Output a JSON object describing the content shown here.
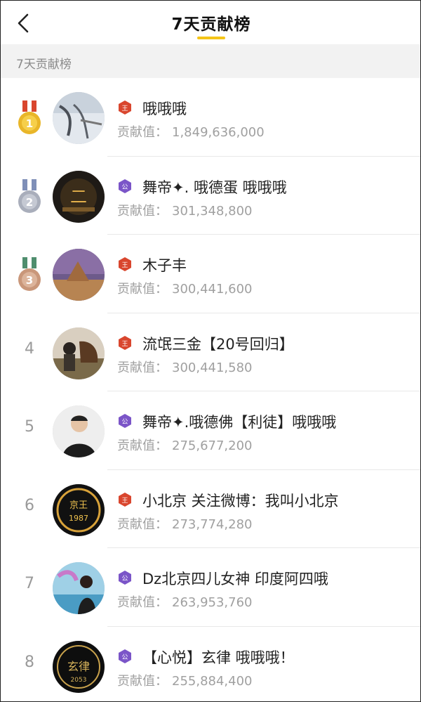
{
  "header": {
    "title": "7天贡献榜"
  },
  "section": {
    "label": "7天贡献榜"
  },
  "contribution_label": "贡献值：",
  "colors": {
    "accent": "#f5c518",
    "gold_medal": "#e9b629",
    "silver_medal": "#a9aebb",
    "bronze_medal": "#c9977a",
    "red_badge": "#d9462e",
    "purple_badge": "#7b55c8"
  },
  "rows": [
    {
      "rank": "1",
      "medal": "gold",
      "badge": "王",
      "badge_color": "red",
      "name": "哦哦哦",
      "value": "1,849,636,000"
    },
    {
      "rank": "2",
      "medal": "silver",
      "badge": "公",
      "badge_color": "purple",
      "name": "舞帝✦. 哦德蛋 哦哦哦",
      "value": "301,348,800"
    },
    {
      "rank": "3",
      "medal": "bronze",
      "badge": "王",
      "badge_color": "red",
      "name": "木子丰",
      "value": "300,441,600"
    },
    {
      "rank": "4",
      "medal": "",
      "badge": "王",
      "badge_color": "red",
      "name": "流氓三金【20号回归】",
      "value": "300,441,580"
    },
    {
      "rank": "5",
      "medal": "",
      "badge": "公",
      "badge_color": "purple",
      "name": "舞帝✦.哦德佛【利徒】哦哦哦",
      "value": "275,677,200"
    },
    {
      "rank": "6",
      "medal": "",
      "badge": "王",
      "badge_color": "red",
      "name": "小北京 关注微博：我叫小北京",
      "value": "273,774,280"
    },
    {
      "rank": "7",
      "medal": "",
      "badge": "公",
      "badge_color": "purple",
      "name": "Dz北京四儿女神 印度阿四哦",
      "value": "263,953,760"
    },
    {
      "rank": "8",
      "medal": "",
      "badge": "公",
      "badge_color": "purple",
      "name": "【心悦】玄律 哦哦哦！",
      "value": "255,884,400"
    }
  ]
}
